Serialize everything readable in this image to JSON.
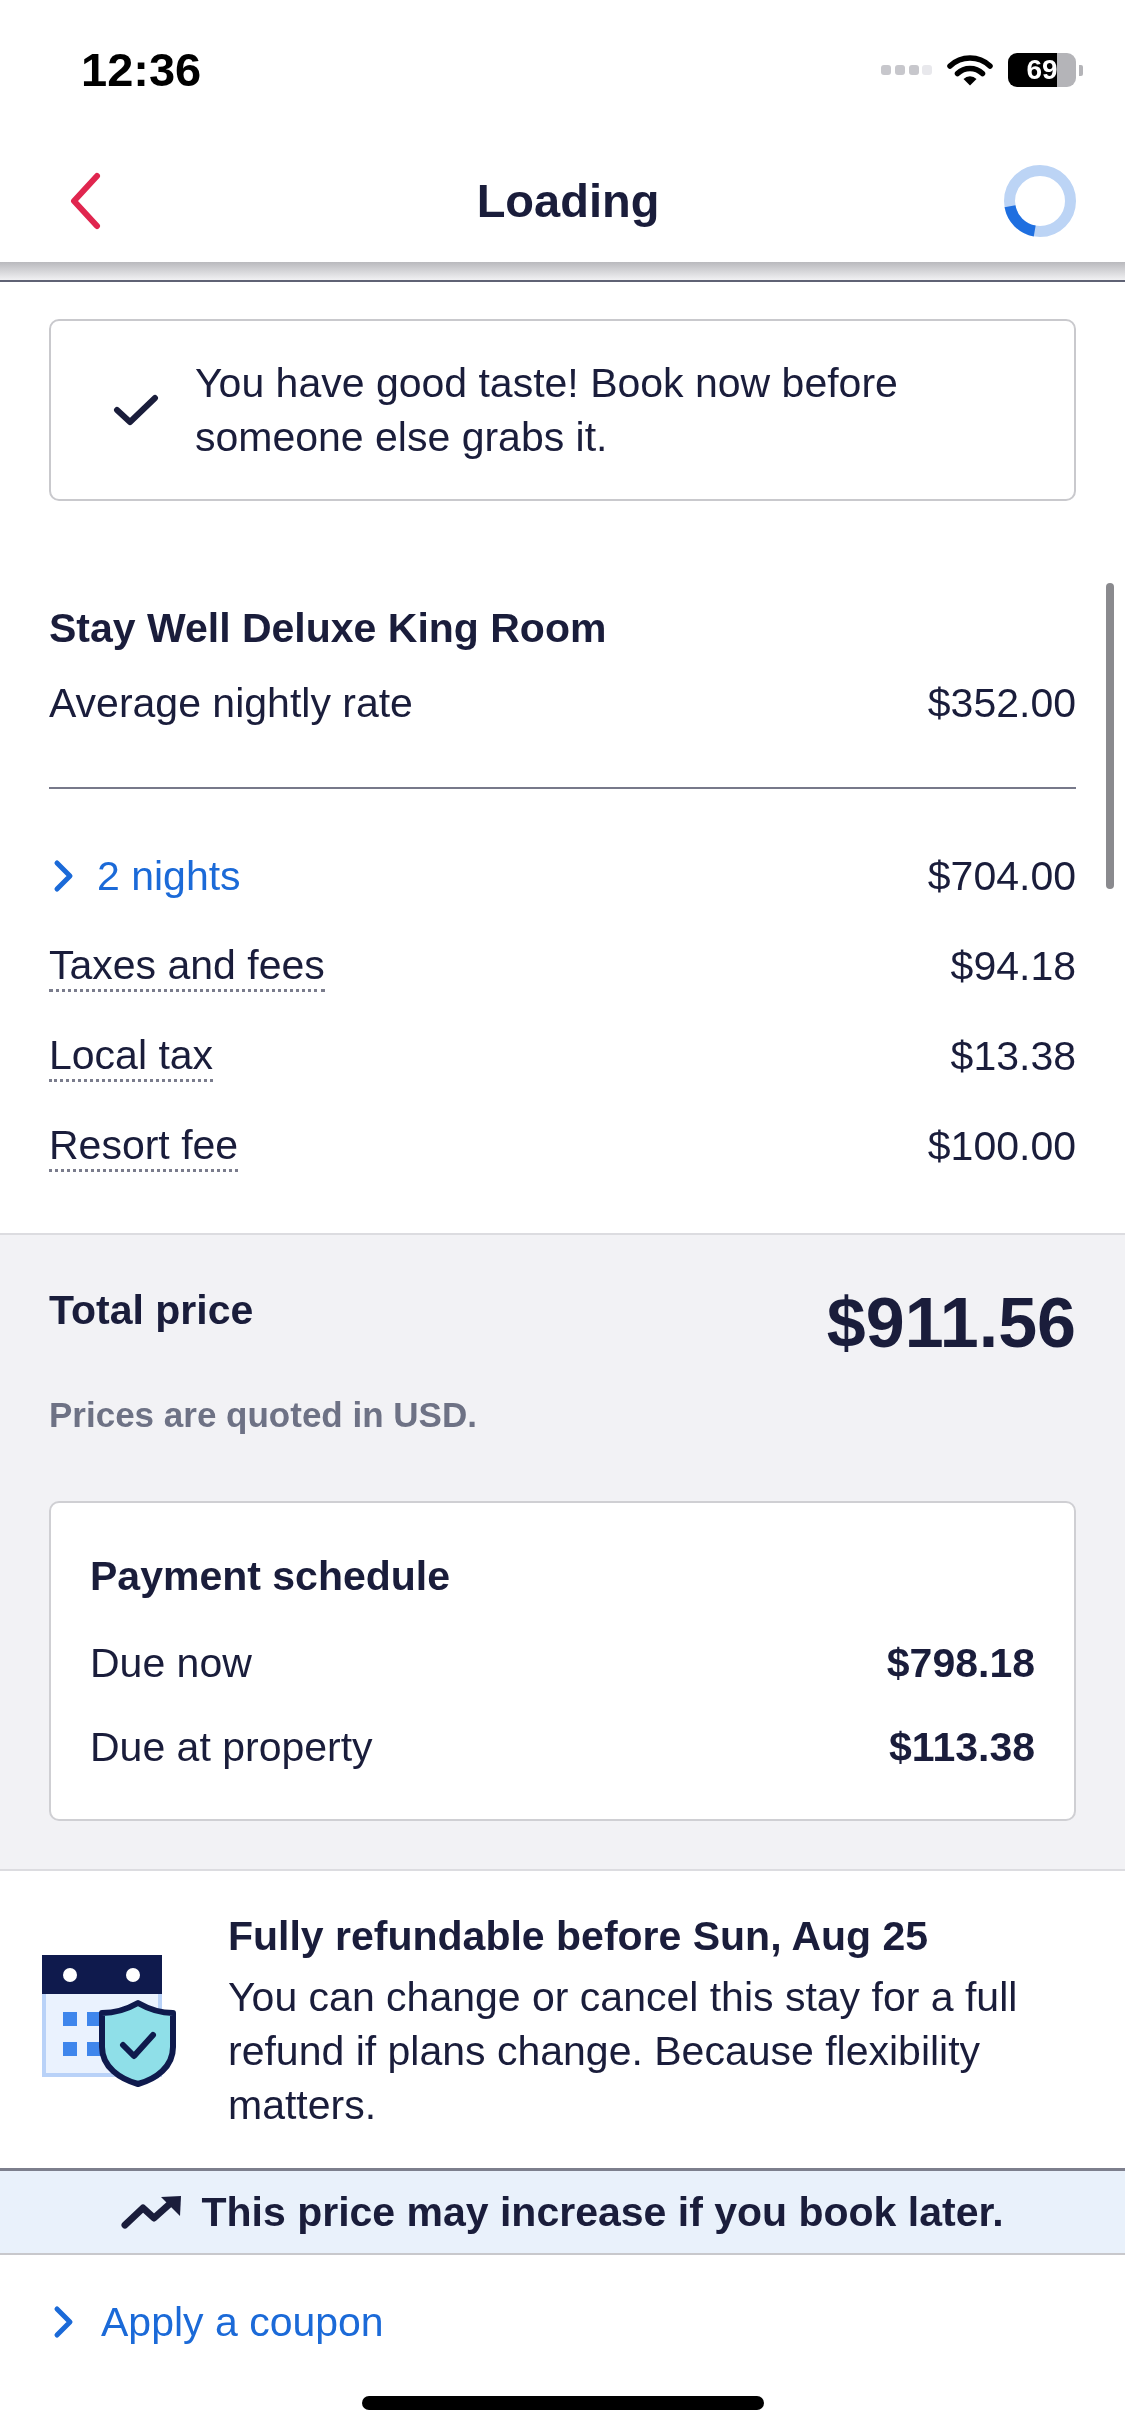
{
  "status_bar": {
    "time": "12:36",
    "battery": "69"
  },
  "header": {
    "title": "Loading"
  },
  "banner": {
    "message": "You have good taste! Book now before someone else grabs it."
  },
  "room": {
    "name": "Stay Well Deluxe King Room",
    "rate_label": "Average nightly rate",
    "rate": "$352.00"
  },
  "nights": {
    "label": "2 nights",
    "amount": "$704.00",
    "expanded": false
  },
  "fees": [
    {
      "label": "Taxes and fees",
      "amount": "$94.18"
    },
    {
      "label": "Local tax",
      "amount": "$13.38"
    },
    {
      "label": "Resort fee",
      "amount": "$100.00"
    }
  ],
  "total": {
    "label": "Total price",
    "amount": "$911.56",
    "note": "Prices are quoted in USD."
  },
  "payment_schedule": {
    "title": "Payment schedule",
    "rows": [
      {
        "label": "Due now",
        "amount": "$798.18"
      },
      {
        "label": "Due at property",
        "amount": "$113.38"
      }
    ]
  },
  "refund": {
    "title": "Fully refundable before Sun, Aug 25",
    "body": "You can change or cancel this stay for a full refund if plans change. Because flexibility matters."
  },
  "price_alert": {
    "message": "This price may increase if you book later."
  },
  "coupon": {
    "label": "Apply a coupon",
    "expanded": false
  }
}
